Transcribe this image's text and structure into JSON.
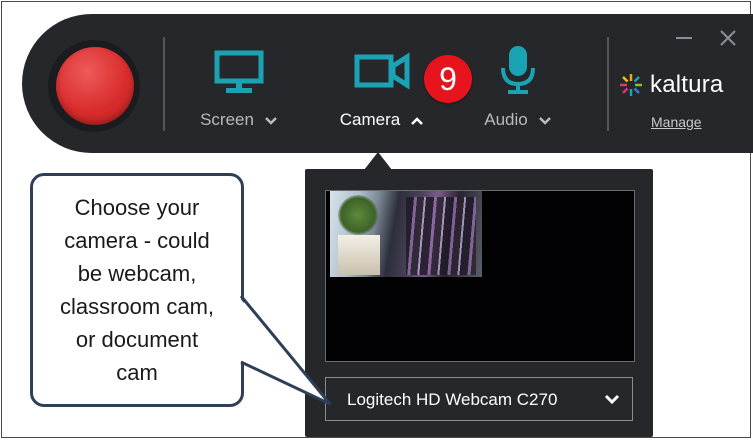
{
  "toolbar": {
    "record_button_color": "#d92d2d",
    "tools": [
      {
        "id": "screen",
        "label": "Screen",
        "icon": "monitor-icon",
        "expanded": false
      },
      {
        "id": "camera",
        "label": "Camera",
        "icon": "video-camera-icon",
        "expanded": true
      },
      {
        "id": "audio",
        "label": "Audio",
        "icon": "microphone-icon",
        "expanded": false
      }
    ],
    "accent_color": "#1aa3b3",
    "brand": {
      "name": "kaltura",
      "manage_label": "Manage"
    },
    "window_controls": {
      "minimize_icon": "minimize-icon",
      "close_icon": "close-icon"
    }
  },
  "step_badge": {
    "number": "9",
    "color": "#e8141d"
  },
  "camera_panel": {
    "selected_device": "Logitech HD Webcam C270"
  },
  "callout": {
    "lines": [
      "Choose your",
      "camera - could",
      "be webcam,",
      "classroom cam,",
      "or document",
      "cam"
    ]
  }
}
